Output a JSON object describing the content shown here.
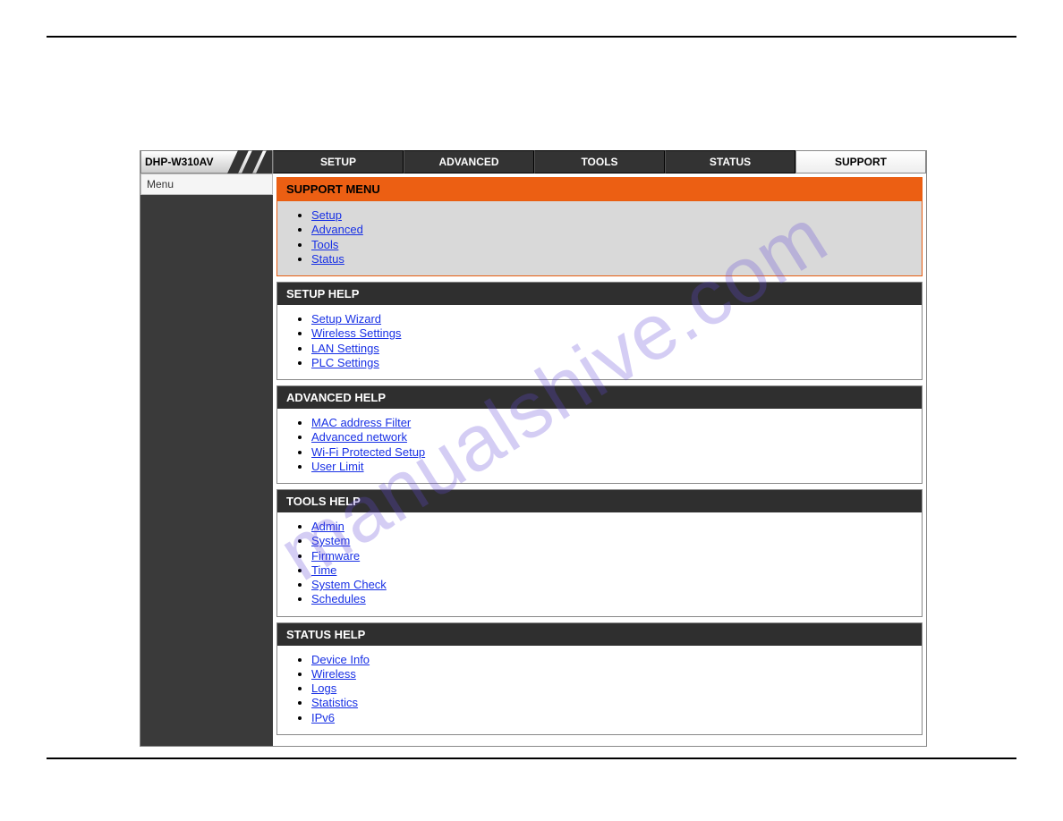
{
  "watermark": "manualshive.com",
  "model": "DHP-W310AV",
  "nav": {
    "setup": "SETUP",
    "advanced": "ADVANCED",
    "tools": "TOOLS",
    "status": "STATUS",
    "support": "SUPPORT"
  },
  "sidebar": {
    "menu_label": "Menu"
  },
  "support_menu": {
    "title": "SUPPORT MENU",
    "items": {
      "setup": "Setup",
      "advanced": "Advanced",
      "tools": "Tools",
      "status": "Status"
    }
  },
  "setup_help": {
    "title": "SETUP HELP",
    "items": {
      "wizard": "Setup Wizard",
      "wireless": "Wireless Settings",
      "lan": "LAN Settings",
      "plc": "PLC Settings"
    }
  },
  "advanced_help": {
    "title": "ADVANCED HELP",
    "items": {
      "mac": "MAC address Filter",
      "net": "Advanced network",
      "wps": "Wi-Fi Protected Setup",
      "ulimit": "User Limit"
    }
  },
  "tools_help": {
    "title": "TOOLS HELP",
    "items": {
      "admin": "Admin",
      "system": "System",
      "firmware": "Firmware",
      "time": "Time",
      "check": "System Check",
      "sched": "Schedules"
    }
  },
  "status_help": {
    "title": "STATUS HELP",
    "items": {
      "device": "Device Info",
      "wireless": "Wireless",
      "logs": "Logs",
      "stats": "Statistics",
      "ipv6": "IPv6"
    }
  }
}
